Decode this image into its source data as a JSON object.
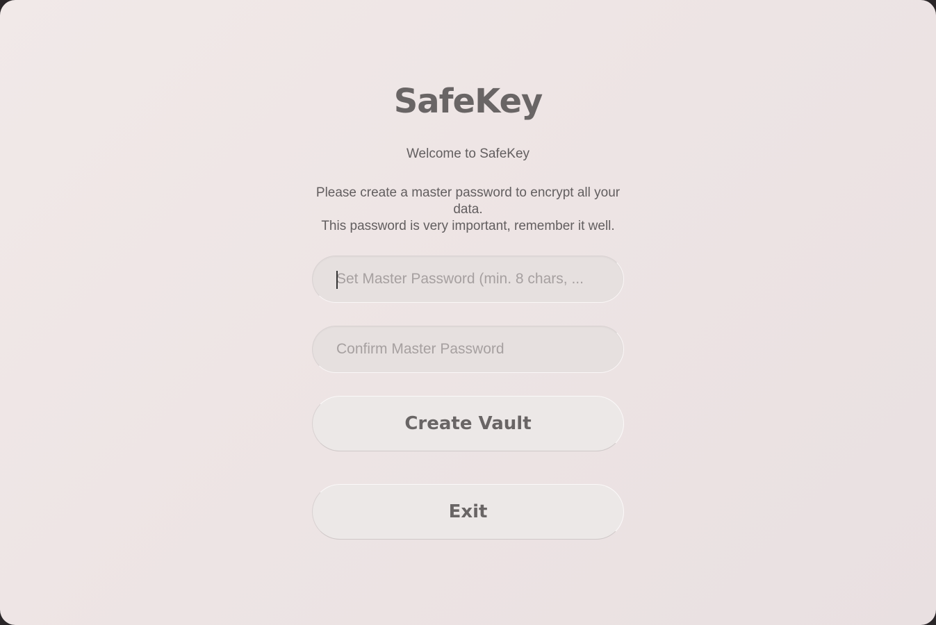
{
  "app": {
    "title": "SafeKey",
    "welcome": "Welcome to SafeKey",
    "description_line1": "Please create a master password to encrypt all your data.",
    "description_line2": "This password is very important, remember it well."
  },
  "form": {
    "master_password": {
      "placeholder": "Set Master Password (min. 8 chars, ...",
      "value": ""
    },
    "confirm_password": {
      "placeholder": "Confirm Master Password",
      "value": ""
    }
  },
  "buttons": {
    "create_label": "Create Vault",
    "exit_label": "Exit"
  },
  "colors": {
    "background": "#eee6e5",
    "text": "#696565",
    "field_bg": "#e6e0df",
    "button_bg": "#ece8e7"
  }
}
